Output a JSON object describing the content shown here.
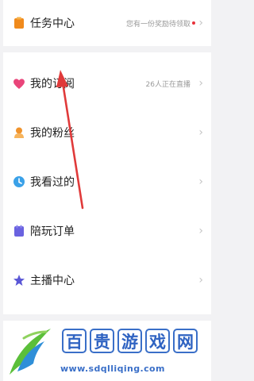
{
  "task_center": {
    "label": "任务中心",
    "hint": "您有一份奖励待领取",
    "icon": "task-icon",
    "color": "#f08a1c"
  },
  "menu": {
    "items": [
      {
        "label": "我的订阅",
        "hint": "26人正在直播",
        "icon": "heart-icon",
        "color": "#e9457a"
      },
      {
        "label": "我的粉丝",
        "hint": "",
        "icon": "fan-icon",
        "color": "#f0932c"
      },
      {
        "label": "我看过的",
        "hint": "",
        "icon": "history-icon",
        "color": "#3aa1e8"
      },
      {
        "label": "陪玩订单",
        "hint": "",
        "icon": "order-icon",
        "color": "#6a62e0"
      },
      {
        "label": "主播中心",
        "hint": "",
        "icon": "star-icon",
        "color": "#5a57d6"
      }
    ]
  },
  "watermark": {
    "title_chars": [
      "百",
      "贵",
      "游",
      "戏",
      "网"
    ],
    "url": "www.sdqlliqing.com"
  },
  "colors": {
    "arrow": "#e03a3a",
    "watermark": "#3a6fc8"
  }
}
